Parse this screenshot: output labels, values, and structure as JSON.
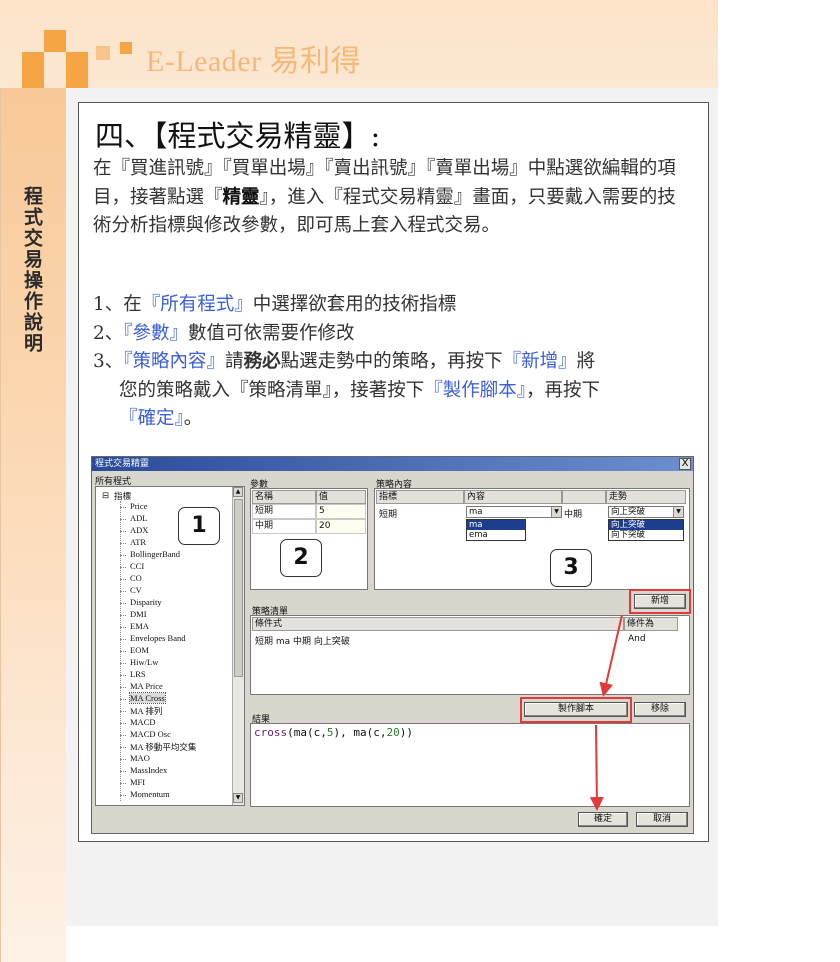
{
  "brand": {
    "name": "E-Leader 易利得"
  },
  "sidebar": {
    "vertical_title": "程式交易操作說明"
  },
  "section": {
    "heading": "四、【程式交易精靈】:",
    "intro_a": "在『買進訊號』『買單出場』『賣出訊號』『賣單出場』中點選欲編輯的項目，接著點選『",
    "intro_bold": "精靈",
    "intro_b": "』，進入『程式交易精靈』畫面，只要戴入需要的技術分析指標與修改參數，即可馬上套入程式交易。",
    "step1_prefix": "1、在",
    "step1_blue": "『所有程式』",
    "step1_suffix": "中選擇欲套用的技術指標",
    "step2_prefix": "2、",
    "step2_blue": "『參數』",
    "step2_suffix": "數值可依需要作修改",
    "step3_prefix": "3、",
    "step3_blue": "『策略內容』",
    "step3_mid": "請",
    "step3_bold": "務必",
    "step3_mid2": "點選走勢中的策略，再按下",
    "step3_blue2": "『新增』",
    "step3_suffix": "將",
    "step3_line2a": "您的策略戴入『策略清單』，接著按下",
    "step3_blue3": "『製作腳本』",
    "step3_line2b": "，再按下",
    "step3_blue4": "『確定』",
    "step3_line3": "。"
  },
  "dialog": {
    "title": "程式交易精靈",
    "close": "X",
    "all_programs_label": "所有程式",
    "tree_root": "指標",
    "tree_items": [
      "Price",
      "ADL",
      "ADX",
      "ATR",
      "BollingerBand",
      "CCI",
      "CO",
      "CV",
      "Disparity",
      "DMI",
      "EMA",
      "Envelopes Band",
      "EOM",
      "Hiw/Lw",
      "LRS",
      "MA Price",
      "MA Cross",
      "MA 排列",
      "MACD",
      "MACD Osc",
      "MA 移動平均交集",
      "MAO",
      "MassIndex",
      "MFI",
      "Momentum"
    ],
    "params_label": "參數",
    "params_headers": [
      "名稱",
      "值"
    ],
    "params_rows": [
      [
        "短期",
        "5"
      ],
      [
        "中期",
        "20"
      ]
    ],
    "strategy_content_label": "策略內容",
    "strategy_headers": [
      "指標",
      "內容",
      "",
      "走勢"
    ],
    "strategy_row_indicator": "短期",
    "strategy_row_content": "ma",
    "strategy_row_period": "中期",
    "strategy_row_trend": "向上突破",
    "content_options": [
      "ma",
      "ema"
    ],
    "trend_options": [
      "向上突破",
      "向下突破"
    ],
    "add_button": "新增",
    "strategy_list_label": "策略清單",
    "strategy_list_headers": [
      "條件式",
      "條件為"
    ],
    "strategy_list_rows": [
      [
        "短期 ma 中期 向上突破",
        "And"
      ]
    ],
    "make_script_button": "製作腳本",
    "remove_button": "移除",
    "result_label": "結果",
    "result_code_fn": "cross",
    "result_code_a": "(ma(c,",
    "result_code_n1": "5",
    "result_code_b": "), ma(c,",
    "result_code_n2": "20",
    "result_code_c": "))",
    "ok_button": "確定",
    "cancel_button": "取消",
    "callouts": [
      "1",
      "2",
      "3"
    ]
  },
  "colors": {
    "accent_orange": "#f6a544",
    "highlight_red": "#e03a3a",
    "link_blue": "#3b5fd8"
  }
}
